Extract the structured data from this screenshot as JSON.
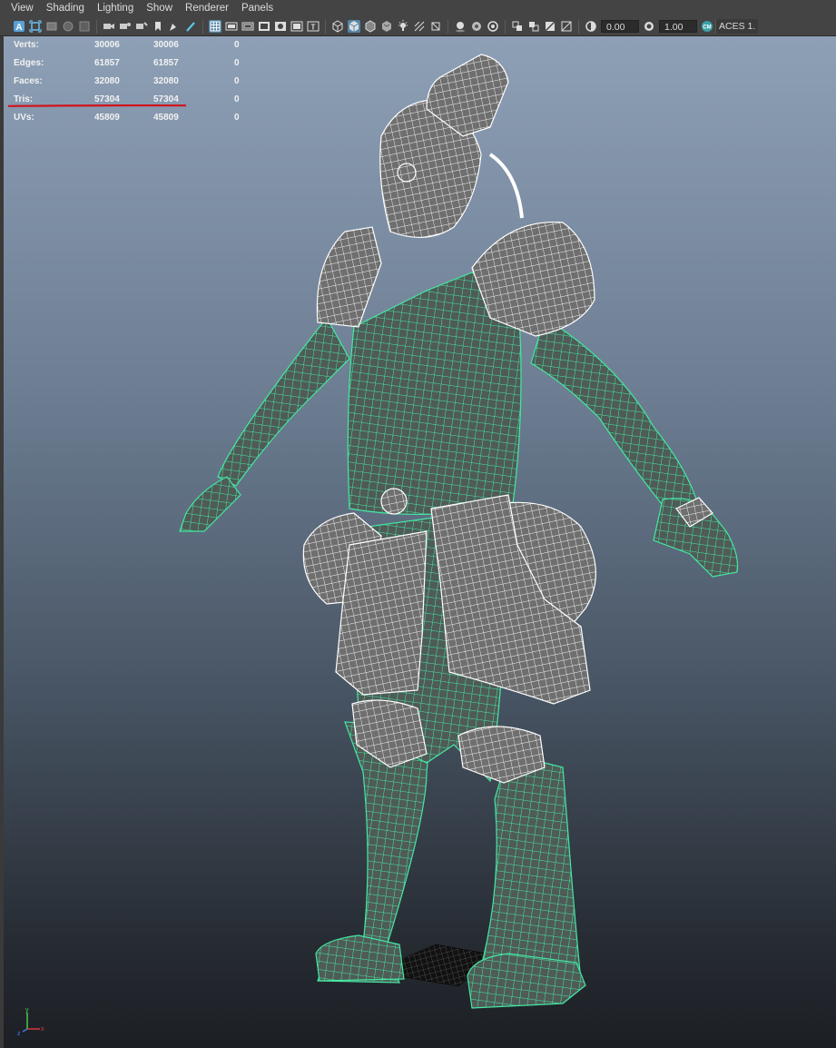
{
  "menu": {
    "items": [
      "View",
      "Shading",
      "Lighting",
      "Show",
      "Renderer",
      "Panels"
    ]
  },
  "toolbar": {
    "field1_value": "0.00",
    "field2_value": "1.00",
    "color_space_label": "ACES 1.",
    "colors": {
      "bar": "#444444",
      "active": "#5285a6"
    }
  },
  "hud": {
    "rows": [
      {
        "label": "Verts:",
        "v1": "30006",
        "v2": "30006",
        "v3": "0"
      },
      {
        "label": "Edges:",
        "v1": "61857",
        "v2": "61857",
        "v3": "0"
      },
      {
        "label": "Faces:",
        "v1": "32080",
        "v2": "32080",
        "v3": "0"
      },
      {
        "label": "Tris:",
        "v1": "57304",
        "v2": "57304",
        "v3": "0"
      },
      {
        "label": "UVs:",
        "v1": "45809",
        "v2": "45809",
        "v3": "0"
      }
    ],
    "annotation_color": "#d0141b"
  },
  "axis": {
    "x_label": "x",
    "y_label": "y",
    "z_label": "z"
  },
  "viewport": {
    "wire_selected": "#44e8a3",
    "wire_unselected": "#ffffff"
  }
}
